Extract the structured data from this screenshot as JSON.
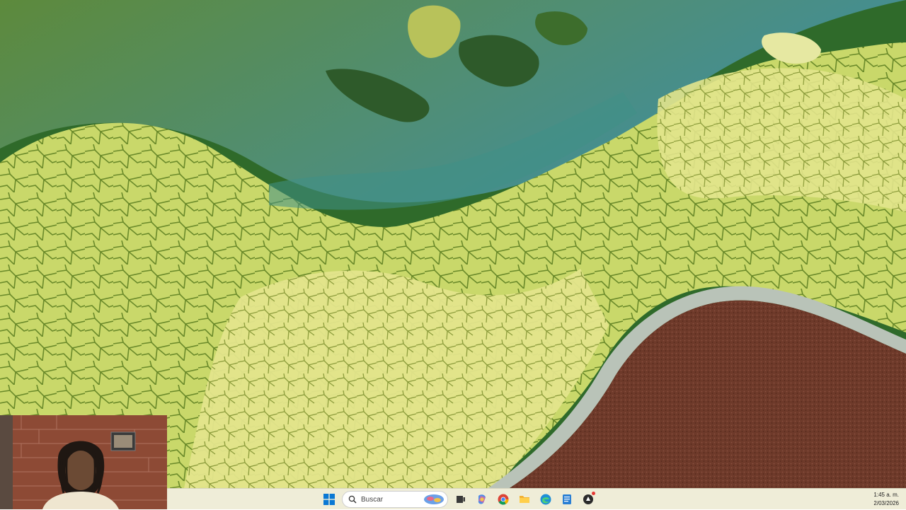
{
  "desktop": {
    "wallpaper": "aerial-algae-landscape"
  },
  "webcam": {
    "description_icon": "person-webcam-icon"
  },
  "taskbar": {
    "start_icon": "windows-start-icon",
    "search": {
      "placeholder": "Buscar",
      "icon": "search-icon"
    },
    "apps": [
      {
        "name": "task-view-icon"
      },
      {
        "name": "copilot-icon"
      },
      {
        "name": "chrome-icon"
      },
      {
        "name": "file-explorer-icon"
      },
      {
        "name": "edge-icon"
      },
      {
        "name": "notepad-icon"
      },
      {
        "name": "notification-app-icon"
      }
    ],
    "clock": {
      "time": "1:45 a. m.",
      "date": "2/03/2026"
    },
    "colors": {
      "taskbar_bg": "#eeecd6",
      "start_blue": "#0a78d4"
    }
  }
}
